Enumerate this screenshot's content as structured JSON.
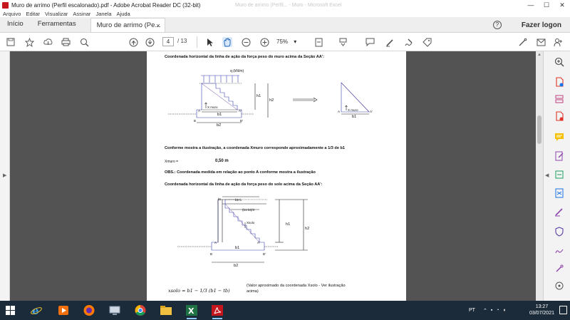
{
  "window": {
    "title": "Muro de arrimo (Perfil escalonado).pdf - Adobe Acrobat Reader DC (32-bit)",
    "faded_title": "Muro de arrimo (Perfil... - Muro - Microsoft Excel",
    "controls": [
      "—",
      "☐",
      "✕"
    ]
  },
  "menu": [
    "Arquivo",
    "Editar",
    "Visualizar",
    "Assinar",
    "Janela",
    "Ajuda"
  ],
  "tabs": {
    "home": "Início",
    "tools": "Ferramentas",
    "document": "Muro de arrimo (Pe...",
    "close": "×",
    "help": "?",
    "login": "Fazer logon"
  },
  "toolbar": {
    "current_page": "4",
    "total_pages": "/ 13",
    "zoom": "75%",
    "zoom_dropdown": "▾"
  },
  "document": {
    "heading1": "Coordenada horizontal da linha de ação da força peso do muro acima da Seção AA':",
    "fig1": {
      "load": "q (kN/m)",
      "h1": "h1",
      "h2": "h2",
      "xmuro": "X muro",
      "b1": "b1",
      "b2": "b2",
      "A": "A",
      "Aprime": "A'",
      "B": "B",
      "Bprime": "B'",
      "tri_xmuro": "X muro",
      "tri_b1": "b1",
      "tri_A": "A",
      "tri_Aprime": "A'"
    },
    "para1": "Conforme mostra a ilustração, a coordenada Xmuro corresponde aproximadamente a 1/3 de b1",
    "xmuro_label": "Xmuro =",
    "xmuro_value": "0,50  m",
    "obs": "OBS.: Coordenada medida em relação ao ponto A conforme mostra a ilustração",
    "heading2": "Coordenada horizontal da linha de ação da força peso do solo acima da Seção AA':",
    "fig2": {
      "b1b": "b1-b",
      "bt": "bt",
      "mid": "(b1-bt)/3",
      "xsolo": "Xsolo",
      "h1": "h1",
      "h2": "h2",
      "b1": "b1",
      "b2": "b2",
      "A": "A",
      "Aprime": "A'",
      "B": "B",
      "Bprime": "B'"
    },
    "formula": "xsolo = b1 − 1/3 (b1 − tb)",
    "formula_note1": "(Valor aproximado da coordenada Xsolo - Ver ilustração",
    "formula_note2": "acima)"
  },
  "taskbar": {
    "lang": "PT",
    "time": "13:27",
    "date": "03/07/2021"
  },
  "colors": {
    "taskbar": "#1c2b3a",
    "acrobat_red": "#c4161c",
    "excel_green": "#1f7244",
    "diagram_blue": "#3a44b0",
    "diagram_purple": "#6a4aa0"
  }
}
